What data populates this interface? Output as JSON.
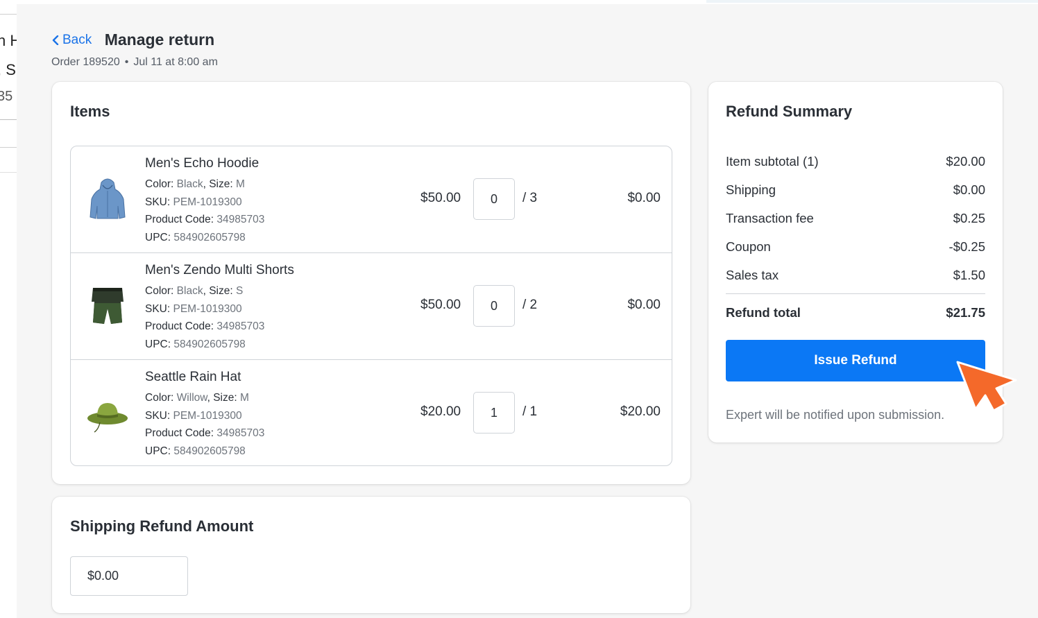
{
  "background": {
    "fragments": [
      "n H",
      ", S",
      "35"
    ]
  },
  "header": {
    "back_label": "Back",
    "title": "Manage return",
    "order_label": "Order 189520",
    "order_date": "Jul 11 at 8:00 am"
  },
  "items": {
    "title": "Items",
    "attr_labels": {
      "color": "Color:",
      "size": "Size:",
      "sku": "SKU:",
      "product_code": "Product Code:",
      "upc": "UPC:"
    },
    "rows": [
      {
        "name": "Men's Echo Hoodie",
        "color": "Black",
        "size": "M",
        "sku": "PEM-1019300",
        "product_code": "34985703",
        "upc": "584902605798",
        "price": "$50.00",
        "qty": "0",
        "qty_total": "/  3",
        "total": "$0.00",
        "icon": "hoodie-icon"
      },
      {
        "name": "Men's Zendo Multi Shorts",
        "color": "Black",
        "size": "S",
        "sku": "PEM-1019300",
        "product_code": "34985703",
        "upc": "584902605798",
        "price": "$50.00",
        "qty": "0",
        "qty_total": "/  2",
        "total": "$0.00",
        "icon": "shorts-icon"
      },
      {
        "name": "Seattle Rain Hat",
        "color": "Willow",
        "size": "M",
        "sku": "PEM-1019300",
        "product_code": "34985703",
        "upc": "584902605798",
        "price": "$20.00",
        "qty": "1",
        "qty_total": "/  1",
        "total": "$20.00",
        "icon": "hat-icon"
      }
    ]
  },
  "shipping": {
    "title": "Shipping Refund Amount",
    "value": "$0.00"
  },
  "summary": {
    "title": "Refund Summary",
    "rows": [
      {
        "label": "Item subtotal (1)",
        "value": "$20.00"
      },
      {
        "label": "Shipping",
        "value": "$0.00"
      },
      {
        "label": "Transaction fee",
        "value": "$0.25"
      },
      {
        "label": "Coupon",
        "value": "-$0.25"
      },
      {
        "label": "Sales tax",
        "value": "$1.50"
      }
    ],
    "total_label": "Refund total",
    "total_value": "$21.75",
    "button_label": "Issue Refund",
    "notice": "Expert will be notified upon submission."
  },
  "colors": {
    "accent": "#0b78f5",
    "link": "#1a73e8",
    "cursor": "#f4692a"
  }
}
